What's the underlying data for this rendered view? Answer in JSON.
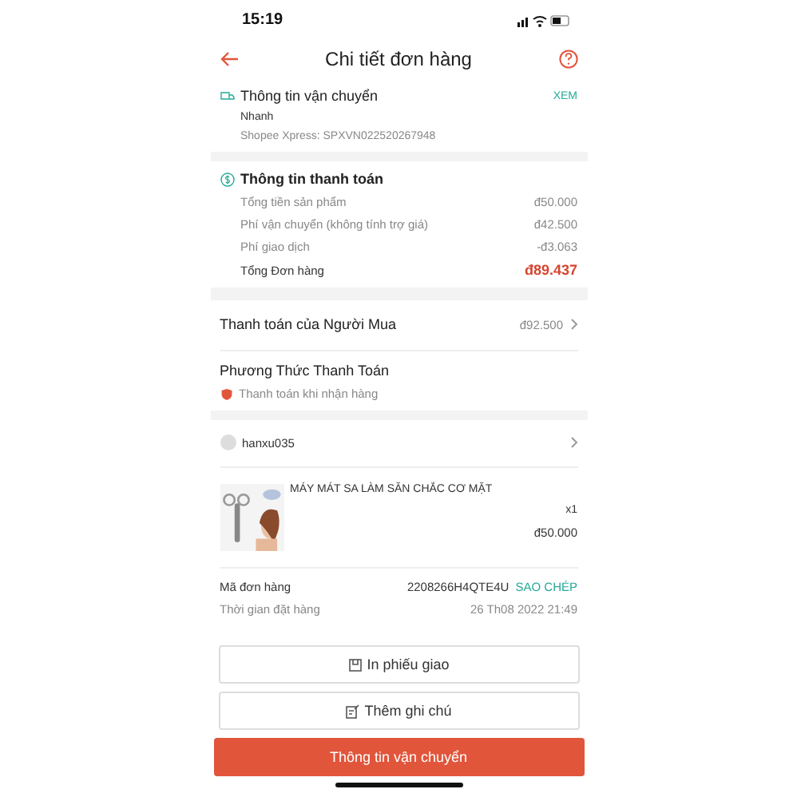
{
  "status_bar": {
    "time": "15:19"
  },
  "header": {
    "title": "Chi tiết đơn hàng"
  },
  "shipping": {
    "title": "Thông tin vận chuyển",
    "action": "XEM",
    "speed": "Nhanh",
    "tracking": "Shopee Xpress: SPXVN022520267948"
  },
  "payment_info": {
    "title": "Thông tin thanh toán",
    "rows": [
      {
        "label": "Tổng tiền sản phẩm",
        "value": "đ50.000",
        "kind": "normal"
      },
      {
        "label": "Phí vận chuyển (không tính trợ giá)",
        "value": "đ42.500",
        "kind": "normal"
      },
      {
        "label": "Phí giao dịch",
        "value": "-đ3.063",
        "kind": "normal"
      },
      {
        "label": "Tổng Đơn hàng",
        "value": "đ89.437",
        "kind": "total"
      }
    ]
  },
  "buyer_payment": {
    "label": "Thanh toán của Người Mua",
    "value": "đ92.500"
  },
  "payment_method": {
    "title": "Phương Thức Thanh Toán",
    "method": "Thanh toán khi nhận hàng"
  },
  "buyer": {
    "username": "hanxu035"
  },
  "product": {
    "name": "MÁY MÁT SA LÀM SĂN CHẮC CƠ MẶT",
    "quantity": "x1",
    "price": "đ50.000"
  },
  "order": {
    "code_label": "Mã đơn hàng",
    "code": "2208266H4QTE4U",
    "copy": "SAO CHÉP",
    "time_label": "Thời gian đặt hàng",
    "time": "26 Th08 2022 21:49"
  },
  "buttons": [
    {
      "label": "In phiếu giao",
      "kind": "print"
    },
    {
      "label": "Thêm ghi chú",
      "kind": "note"
    },
    {
      "label": "Thông tin vận chuyển",
      "kind": "primary"
    }
  ]
}
